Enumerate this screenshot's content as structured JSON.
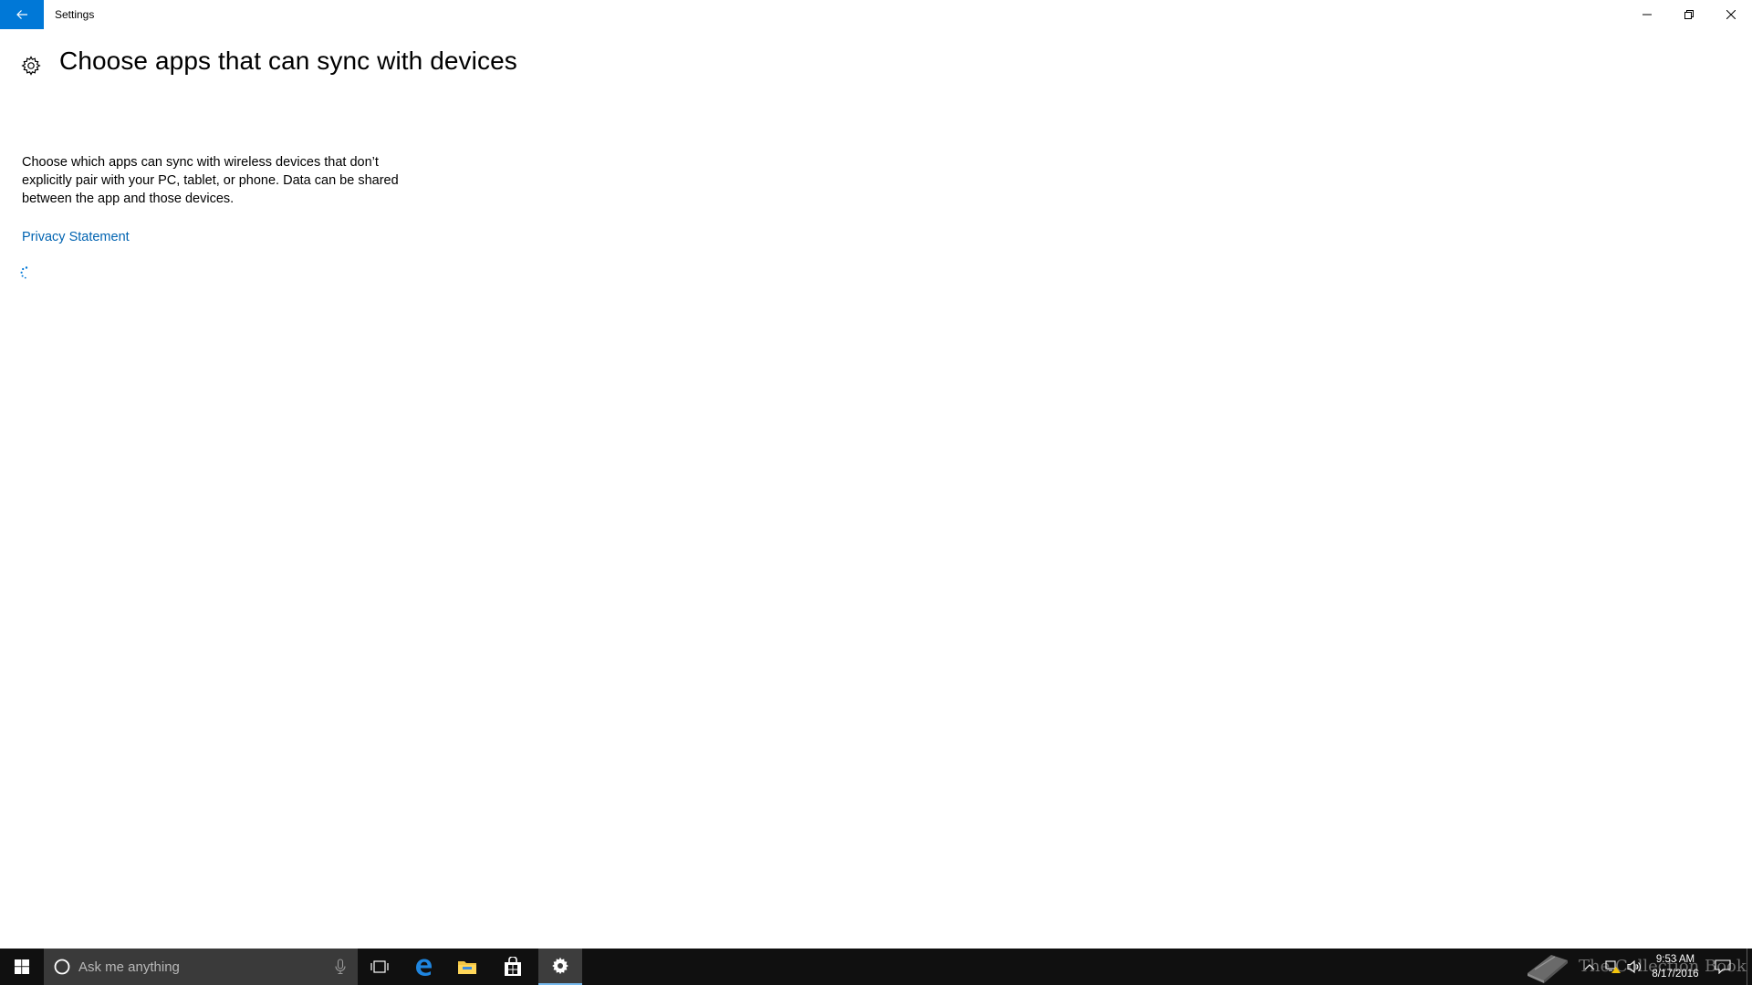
{
  "window": {
    "app_title": "Settings",
    "accent_color": "#0078d7"
  },
  "page": {
    "title": "Choose apps that can sync with devices",
    "description": "Choose which apps can sync with wireless devices that don’t explicitly pair with your PC, tablet, or phone. Data can be shared between the app and those devices.",
    "privacy_link": "Privacy Statement",
    "link_color": "#0063b1"
  },
  "taskbar": {
    "search_placeholder": "Ask me anything",
    "pinned_apps": [
      "task-view",
      "edge",
      "file-explorer",
      "store",
      "settings"
    ],
    "active_app": "settings"
  },
  "tray": {
    "watermark": "The Collection Book",
    "time": "9:53 AM",
    "date": "8/17/2016"
  },
  "icons": {
    "back": "back-arrow-icon",
    "page": "gear-icon",
    "minimize": "minimize-icon",
    "maximize": "restore-icon",
    "close": "close-icon"
  }
}
